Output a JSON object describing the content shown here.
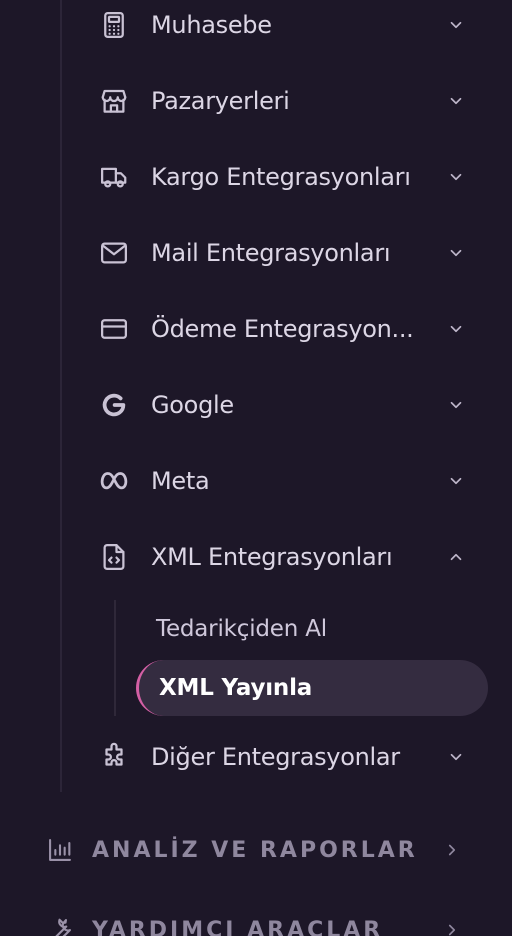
{
  "menu": {
    "items": [
      {
        "label": "Muhasebe",
        "icon": "calculator-icon",
        "expanded": false
      },
      {
        "label": "Pazaryerleri",
        "icon": "store-icon",
        "expanded": false
      },
      {
        "label": "Kargo Entegrasyonları",
        "icon": "truck-icon",
        "expanded": false
      },
      {
        "label": "Mail Entegrasyonları",
        "icon": "mail-icon",
        "expanded": false
      },
      {
        "label": "Ödeme Entegrasyon...",
        "icon": "credit-card-icon",
        "expanded": false
      },
      {
        "label": "Google",
        "icon": "google-icon",
        "expanded": false
      },
      {
        "label": "Meta",
        "icon": "meta-icon",
        "expanded": false
      },
      {
        "label": "XML Entegrasyonları",
        "icon": "file-code-icon",
        "expanded": true
      },
      {
        "label": "Diğer Entegrasyonlar",
        "icon": "puzzle-icon",
        "expanded": false
      }
    ],
    "xml_subitems": [
      {
        "label": "Tedarikçiden Al",
        "active": false
      },
      {
        "label": "XML Yayınla",
        "active": true
      }
    ]
  },
  "sections": [
    {
      "label": "ANALİZ VE RAPORLAR",
      "icon": "bar-chart-icon"
    },
    {
      "label": "YARDIMCI ARAÇLAR",
      "icon": "wrench-icon"
    }
  ],
  "colors": {
    "background": "#1d1728",
    "active_bg": "#342c40",
    "accent": "#d35fa4"
  }
}
